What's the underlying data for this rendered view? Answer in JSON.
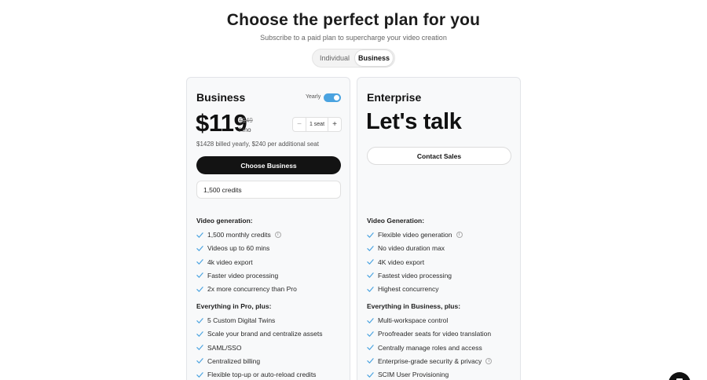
{
  "header": {
    "title": "Choose the perfect plan for you",
    "subtitle": "Subscribe to a paid plan to supercharge your video creation"
  },
  "plan_toggle": {
    "options": [
      "Individual",
      "Business"
    ],
    "selected": "Business"
  },
  "business": {
    "name": "Business",
    "yearly_label": "Yearly",
    "yearly_enabled": true,
    "price": "$119",
    "old_price": "$149",
    "per": "/ mo",
    "seats": {
      "minus": "−",
      "value": "1 seat",
      "plus": "+"
    },
    "billed": "$1428 billed yearly, $240 per additional seat",
    "cta": "Choose Business",
    "credits_option": "1,500 credits",
    "section1_title": "Video generation:",
    "section1_items": [
      "1,500 monthly credits",
      "Videos up to 60 mins",
      "4k video export",
      "Faster video processing",
      "2x more concurrency than Pro"
    ],
    "section2_title": "Everything in Pro, plus:",
    "section2_items": [
      "5 Custom Digital Twins",
      "Scale your brand and centralize assets",
      "SAML/SSO",
      "Centralized billing",
      "Flexible top-up or auto-reload credits"
    ]
  },
  "enterprise": {
    "name": "Enterprise",
    "price": "Let's talk",
    "cta": "Contact Sales",
    "section1_title": "Video Generation:",
    "section1_items": [
      "Flexible video generation",
      "No video duration max",
      "4K video export",
      "Fastest video processing",
      "Highest concurrency"
    ],
    "section2_title": "Everything in Business, plus:",
    "section2_items": [
      "Multi-workspace control",
      "Proofreader seats for video translation",
      "Centrally manage roles and access",
      "Enterprise-grade security & privacy",
      "SCIM User Provisioning"
    ]
  },
  "icons": {
    "check": "check-icon",
    "info": "info-icon",
    "chat": "chat-icon"
  },
  "colors": {
    "accent": "#4aa3e0",
    "check": "#4aa3e0",
    "primary_button": "#131313"
  }
}
